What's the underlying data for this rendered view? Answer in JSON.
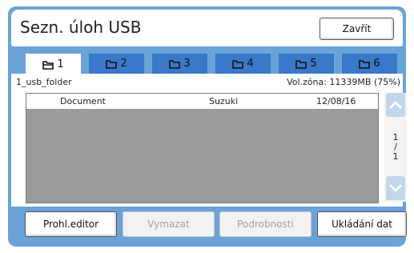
{
  "header": {
    "title": "Sezn. úloh USB",
    "close_label": "Zavřít"
  },
  "tabs": [
    {
      "label": "1",
      "active": true
    },
    {
      "label": "2",
      "active": false
    },
    {
      "label": "3",
      "active": false
    },
    {
      "label": "4",
      "active": false
    },
    {
      "label": "5",
      "active": false
    },
    {
      "label": "6",
      "active": false
    }
  ],
  "info": {
    "folder_name": "1_usb_folder",
    "free_zone": "Vol.zóna: 11339MB (75%)"
  },
  "jobs": [
    {
      "name": "Document",
      "owner": "Suzuki",
      "date": "12/08/16"
    }
  ],
  "pager": {
    "current": "1",
    "separator": "/",
    "total": "1"
  },
  "buttons": {
    "editor": "Prohl.editor",
    "delete": "Vymazat",
    "details": "Podrobnosti",
    "save": "Ukládání dat"
  },
  "colors": {
    "panel": "#6aa3d8",
    "tab": "#3a78c9",
    "list_bg": "#9b9b9b",
    "scroll_btn": "#c4d6ea"
  }
}
